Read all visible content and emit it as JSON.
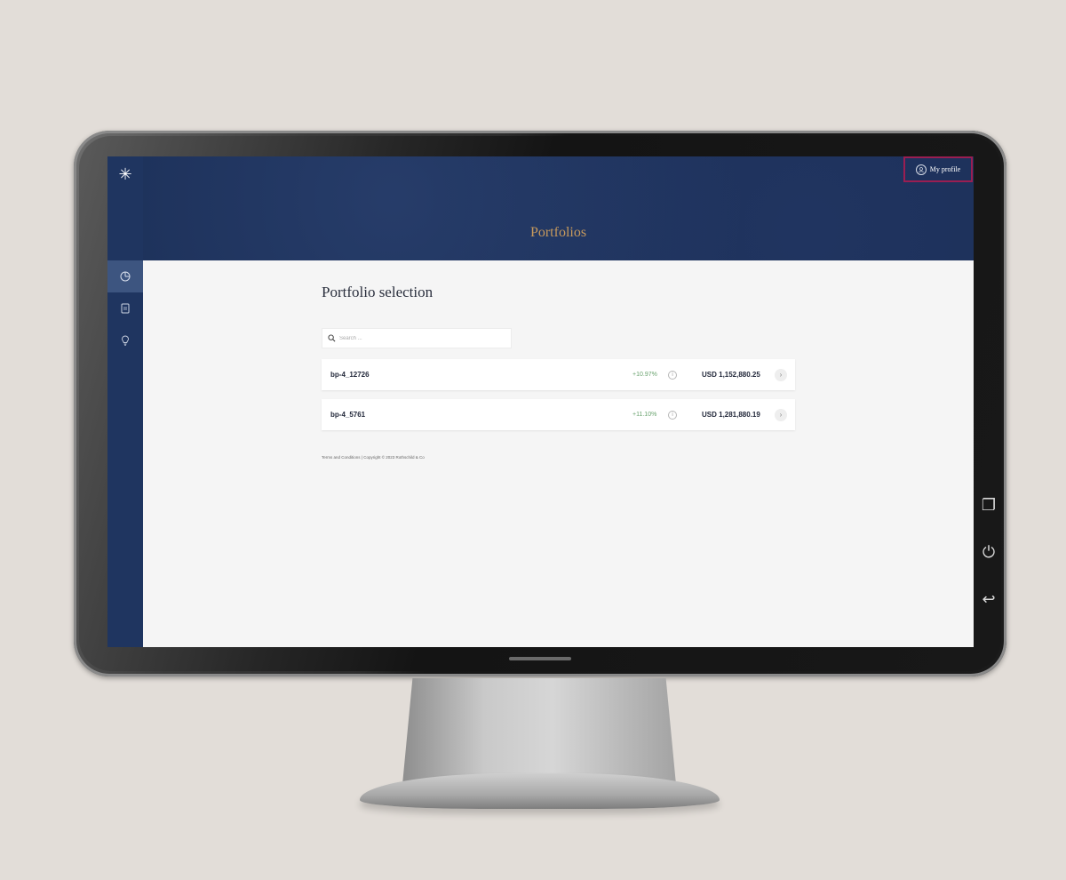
{
  "header": {
    "title": "Portfolios",
    "profile_label": "My profile"
  },
  "sidebar": {
    "logo": "star-logo",
    "items": [
      {
        "icon": "pie-chart-icon",
        "active": true
      },
      {
        "icon": "document-icon",
        "active": false
      },
      {
        "icon": "lightbulb-icon",
        "active": false
      }
    ]
  },
  "main": {
    "title": "Portfolio selection",
    "search": {
      "placeholder": "Search ...",
      "value": ""
    },
    "portfolios": [
      {
        "name": "bp-4_12726",
        "performance": "+10.97%",
        "value": "USD 1,152,880.25"
      },
      {
        "name": "bp-4_5761",
        "performance": "+11.10%",
        "value": "USD 1,281,880.19"
      }
    ]
  },
  "footer": {
    "text": "Terms and Conditions | Copyright © 2023 Rothschild & Co"
  },
  "colors": {
    "sidebar": "#1f3560",
    "banner": "#1b2f57",
    "title_gold": "#c79a5d",
    "highlight_border": "#9a1e52",
    "positive": "#6aa36f"
  }
}
